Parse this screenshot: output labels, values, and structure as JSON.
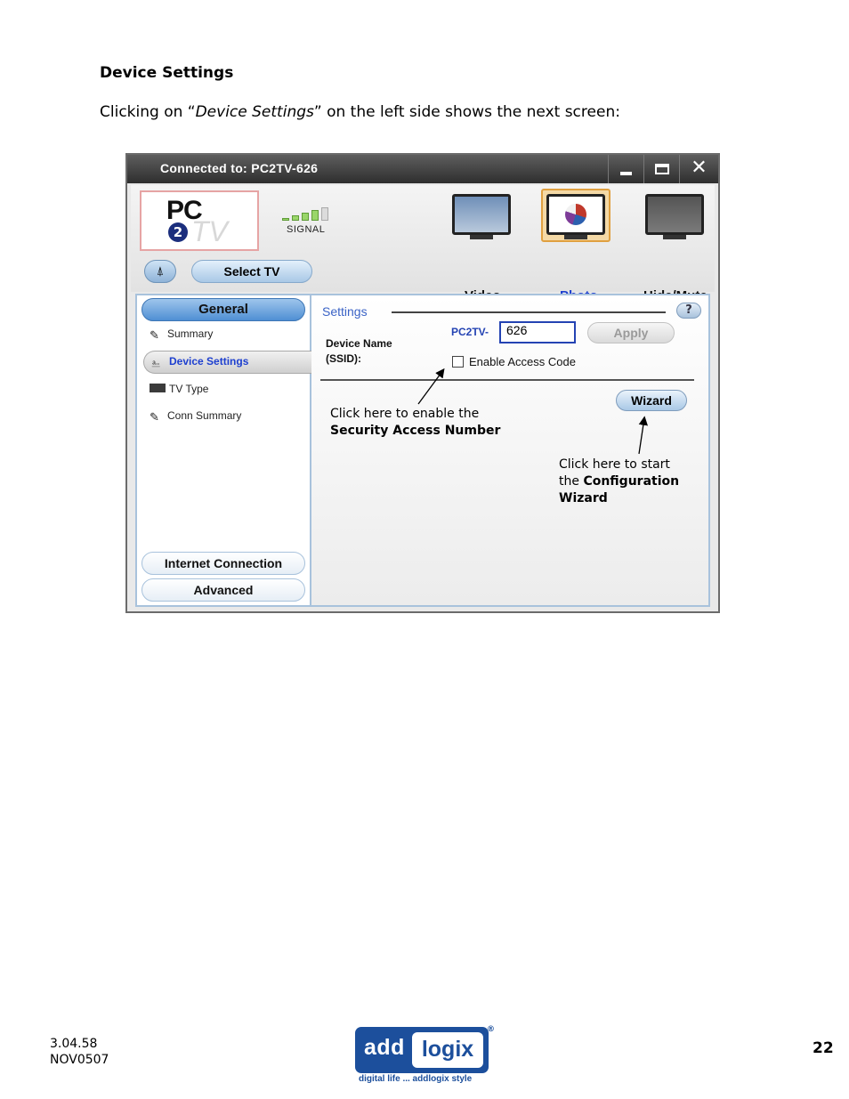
{
  "doc": {
    "heading": "Device Settings",
    "intro_prefix": "Clicking on “",
    "intro_em": "Device Settings",
    "intro_suffix": "” on the left side shows the next screen:"
  },
  "window": {
    "title": "Connected to: PC2TV-626",
    "logo": {
      "pc": "PC",
      "two": "2",
      "tv": "TV"
    },
    "signal_label": "SIGNAL",
    "signal_level": 4,
    "signal_max": 5,
    "select_tv": "Select TV",
    "modes": [
      {
        "label": "Video"
      },
      {
        "label": "Photo",
        "active": true
      },
      {
        "label": "Hide/Mute"
      }
    ],
    "left_panel": {
      "section": "General",
      "items": [
        "Summary",
        "Device Settings",
        "TV Type",
        "Conn Summary"
      ],
      "active_item": "Device Settings",
      "bottom_buttons": [
        "Internet Connection",
        "Advanced"
      ]
    },
    "settings": {
      "title": "Settings",
      "help": "?",
      "device_name_label_1": "Device Name",
      "device_name_label_2": "(SSID):",
      "prefix": "PC2TV-",
      "device_name_value": "626",
      "apply": "Apply",
      "enable_access_code": "Enable Access Code",
      "wizard": "Wizard"
    },
    "notes": {
      "note1_line1": "Click here to enable the",
      "note1_line2": "Security Access Number",
      "note2_line1": "Click here to start",
      "note2_line2_prefix": "the ",
      "note2_line2_bold": "Configuration",
      "note2_line3": "Wizard"
    },
    "colors": {
      "accent_blue": "#1d3fcf",
      "title_bar": "#2e2e2e"
    }
  },
  "footer": {
    "version": "3.04.58",
    "date_code": "NOV0507",
    "page_number": "22",
    "brand_add": "add",
    "brand_logix": "logix",
    "brand_reg": "®",
    "tagline": "digital life ... addlogix style"
  }
}
